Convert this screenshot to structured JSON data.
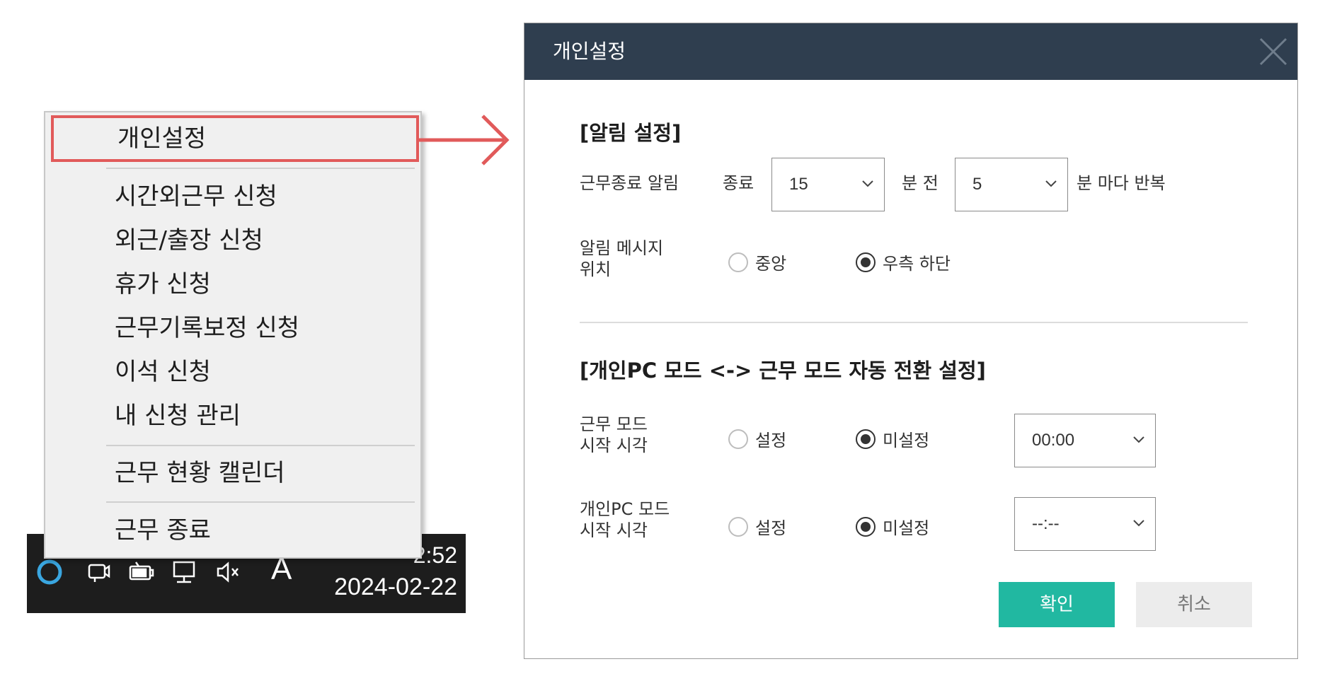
{
  "taskbar": {
    "icons": [
      "circle-app-icon",
      "camera-icon",
      "battery-icon",
      "network-icon",
      "speaker-muted-icon"
    ],
    "input_indicator": "A",
    "time": "2:52",
    "date": "2024-02-22"
  },
  "menu": {
    "items": [
      {
        "label": "개인설정",
        "highlighted": true
      },
      {
        "label": "시간외근무 신청"
      },
      {
        "label": "외근/출장 신청"
      },
      {
        "label": "휴가 신청"
      },
      {
        "label": "근무기록보정 신청"
      },
      {
        "label": "이석 신청"
      },
      {
        "label": "내 신청 관리"
      },
      {
        "label": "근무 현황 캘린더"
      },
      {
        "label": "근무 종료"
      }
    ]
  },
  "dialog": {
    "title": "개인설정",
    "alarm_section": {
      "title": "[알림 설정]",
      "work_end_alarm_label": "근무종료 알림",
      "end_label": "종료",
      "minutes_before_value": "15",
      "minutes_before_suffix": "분 전",
      "repeat_value": "5",
      "repeat_suffix": "분 마다 반복",
      "message_position_label_line1": "알림 메시지",
      "message_position_label_line2": "위치",
      "position_options": [
        "중앙",
        "우측 하단"
      ],
      "position_selected": "우측 하단"
    },
    "mode_section": {
      "title": "[개인PC 모드 <-> 근무 모드 자동 전환 설정]",
      "work_mode_label_line1": "근무 모드",
      "work_mode_label_line2": "시작 시각",
      "work_mode_options": [
        "설정",
        "미설정"
      ],
      "work_mode_selected": "미설정",
      "work_mode_time": "00:00",
      "pc_mode_label_line1": "개인PC 모드",
      "pc_mode_label_line2": "시작 시각",
      "pc_mode_options": [
        "설정",
        "미설정"
      ],
      "pc_mode_selected": "미설정",
      "pc_mode_time": "--:--"
    },
    "ok_label": "확인",
    "cancel_label": "취소"
  },
  "colors": {
    "header_bg": "#2f3e4f",
    "highlight_border": "#e15a5a",
    "ok_button": "#21b8a1"
  }
}
